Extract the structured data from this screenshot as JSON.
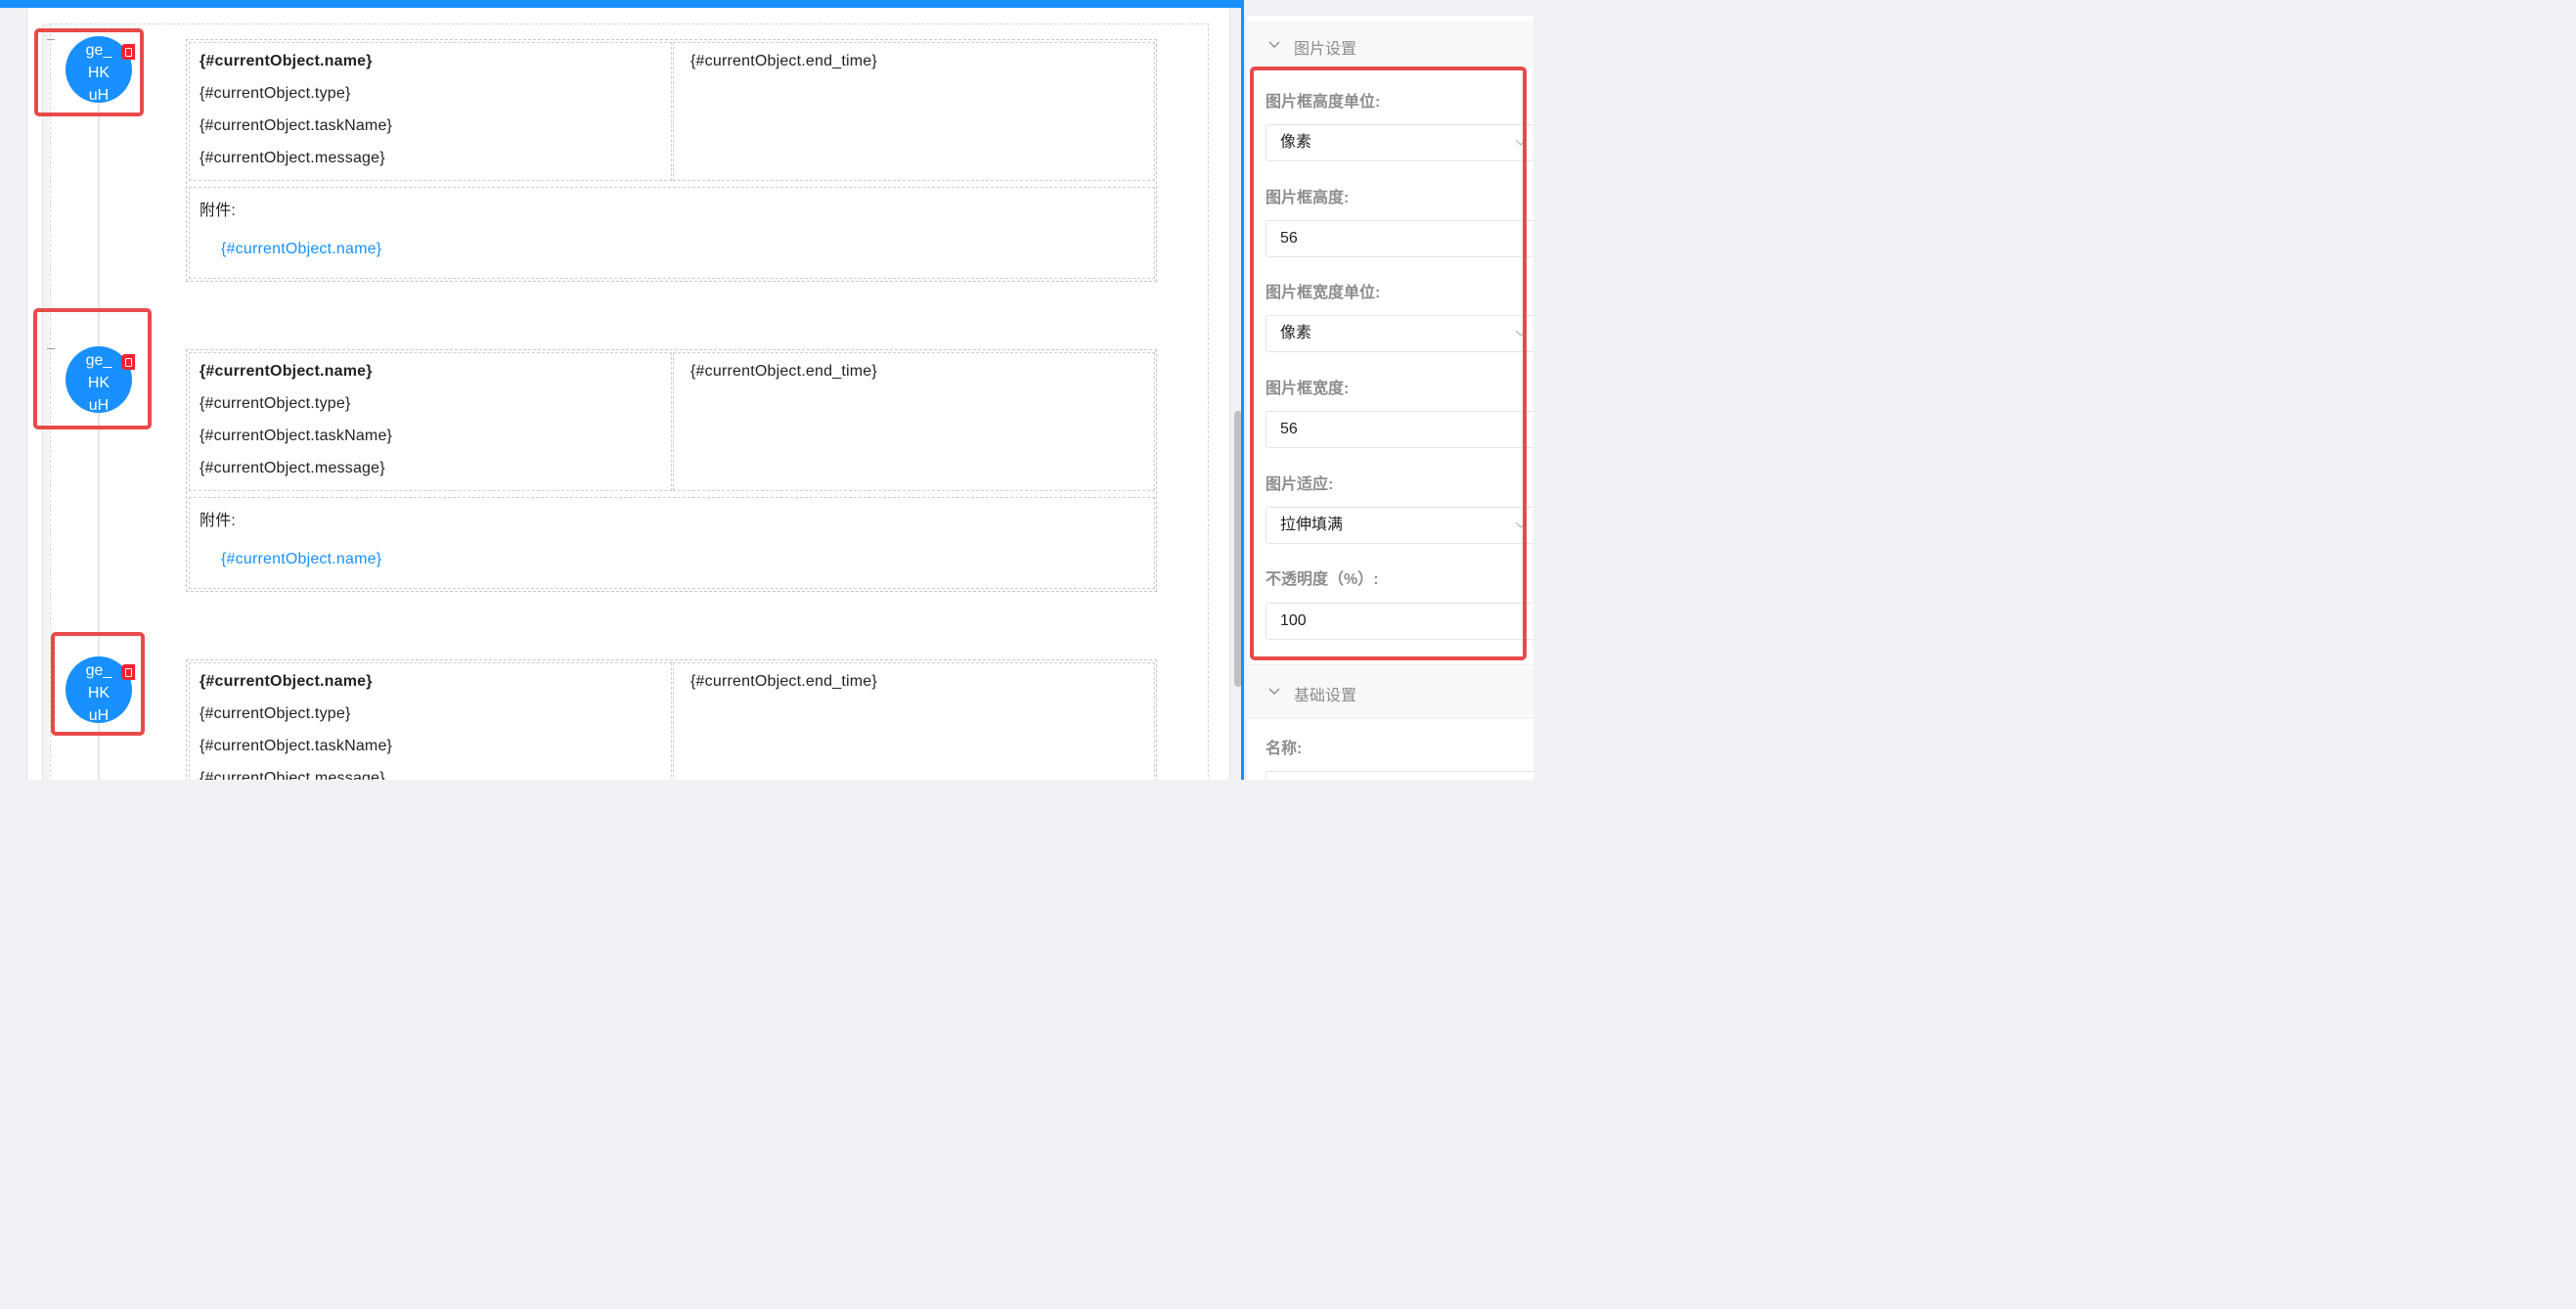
{
  "records": [
    {
      "avatar_lines": [
        "ge_",
        "HK",
        "uH"
      ],
      "name": "{#currentObject.name}",
      "type": "{#currentObject.type}",
      "task_name": "{#currentObject.taskName}",
      "message": "{#currentObject.message}",
      "end_time": "{#currentObject.end_time}",
      "attachment_label": "附件:",
      "attachment_link": "{#currentObject.name}"
    },
    {
      "avatar_lines": [
        "ge_",
        "HK",
        "uH"
      ],
      "name": "{#currentObject.name}",
      "type": "{#currentObject.type}",
      "task_name": "{#currentObject.taskName}",
      "message": "{#currentObject.message}",
      "end_time": "{#currentObject.end_time}",
      "attachment_label": "附件:",
      "attachment_link": "{#currentObject.name}"
    },
    {
      "avatar_lines": [
        "ge_",
        "HK",
        "uH"
      ],
      "name": "{#currentObject.name}",
      "type": "{#currentObject.type}",
      "task_name": "{#currentObject.taskName}",
      "message": "{#currentObject.message}",
      "end_time": "{#currentObject.end_time}"
    }
  ],
  "panel": {
    "image_section": {
      "title": "图片设置",
      "height_unit_label": "图片框高度单位:",
      "height_unit_value": "像素",
      "height_label": "图片框高度:",
      "height_value": "56",
      "width_unit_label": "图片框宽度单位:",
      "width_unit_value": "像素",
      "width_label": "图片框宽度:",
      "width_value": "56",
      "fit_label": "图片适应:",
      "fit_value": "拉伸填满",
      "opacity_label": "不透明度（%）:",
      "opacity_value": "100"
    },
    "basic_section": {
      "title": "基础设置",
      "name_label": "名称:"
    }
  },
  "colors": {
    "accent": "#1890ff",
    "highlight": "#e84a4a",
    "badge": "#f5222d"
  }
}
